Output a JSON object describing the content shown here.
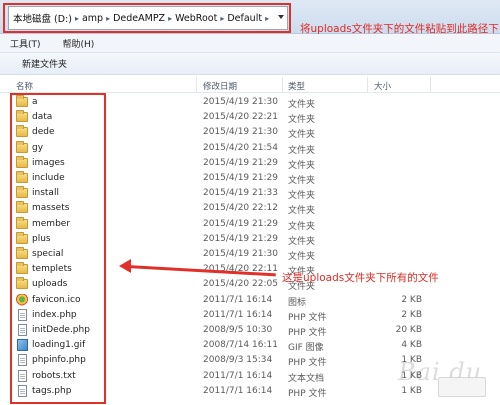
{
  "address": {
    "crumbs": [
      "本地磁盘 (D:)",
      "amp",
      "DedeAMPZ",
      "WebRoot",
      "Default"
    ],
    "separator": "▸"
  },
  "annotations": {
    "top": "将uploads文件夹下的文件粘贴到此路径下",
    "middle": "这是uploads文件夹下所有的文件"
  },
  "menu": {
    "items": [
      "工具(T)",
      "帮助(H)"
    ]
  },
  "toolbar": {
    "new_folder": "新建文件夹"
  },
  "columns": [
    "名称",
    "修改日期",
    "类型",
    "大小"
  ],
  "files": [
    {
      "name": "a",
      "date": "2015/4/19 21:30",
      "type": "文件夹",
      "size": "",
      "icon": "folder-icon"
    },
    {
      "name": "data",
      "date": "2015/4/20 22:21",
      "type": "文件夹",
      "size": "",
      "icon": "folder-icon"
    },
    {
      "name": "dede",
      "date": "2015/4/19 21:30",
      "type": "文件夹",
      "size": "",
      "icon": "folder-icon"
    },
    {
      "name": "gy",
      "date": "2015/4/20 21:54",
      "type": "文件夹",
      "size": "",
      "icon": "folder-icon"
    },
    {
      "name": "images",
      "date": "2015/4/19 21:29",
      "type": "文件夹",
      "size": "",
      "icon": "folder-icon"
    },
    {
      "name": "include",
      "date": "2015/4/19 21:29",
      "type": "文件夹",
      "size": "",
      "icon": "folder-icon"
    },
    {
      "name": "install",
      "date": "2015/4/19 21:33",
      "type": "文件夹",
      "size": "",
      "icon": "folder-icon"
    },
    {
      "name": "massets",
      "date": "2015/4/20 22:12",
      "type": "文件夹",
      "size": "",
      "icon": "folder-icon"
    },
    {
      "name": "member",
      "date": "2015/4/19 21:29",
      "type": "文件夹",
      "size": "",
      "icon": "folder-icon"
    },
    {
      "name": "plus",
      "date": "2015/4/19 21:29",
      "type": "文件夹",
      "size": "",
      "icon": "folder-icon"
    },
    {
      "name": "special",
      "date": "2015/4/19 21:30",
      "type": "文件夹",
      "size": "",
      "icon": "folder-icon"
    },
    {
      "name": "templets",
      "date": "2015/4/20 22:11",
      "type": "文件夹",
      "size": "",
      "icon": "folder-icon"
    },
    {
      "name": "uploads",
      "date": "2015/4/20 22:05",
      "type": "文件夹",
      "size": "",
      "icon": "folder-icon"
    },
    {
      "name": "favicon.ico",
      "date": "2011/7/1 16:14",
      "type": "图标",
      "size": "2 KB",
      "icon": "ico-icon"
    },
    {
      "name": "index.php",
      "date": "2011/7/1 16:14",
      "type": "PHP 文件",
      "size": "2 KB",
      "icon": "file-icon"
    },
    {
      "name": "initDede.php",
      "date": "2008/9/5 10:30",
      "type": "PHP 文件",
      "size": "20 KB",
      "icon": "file-icon"
    },
    {
      "name": "loading1.gif",
      "date": "2008/7/14 16:11",
      "type": "GIF 图像",
      "size": "4 KB",
      "icon": "image-icon"
    },
    {
      "name": "phpinfo.php",
      "date": "2008/9/3 15:34",
      "type": "PHP 文件",
      "size": "1 KB",
      "icon": "file-icon"
    },
    {
      "name": "robots.txt",
      "date": "2011/7/1 16:14",
      "type": "文本文档",
      "size": "1 KB",
      "icon": "file-icon"
    },
    {
      "name": "tags.php",
      "date": "2011/7/1 16:14",
      "type": "PHP 文件",
      "size": "1 KB",
      "icon": "file-icon"
    }
  ],
  "colors": {
    "annotation": "#e0302a"
  }
}
